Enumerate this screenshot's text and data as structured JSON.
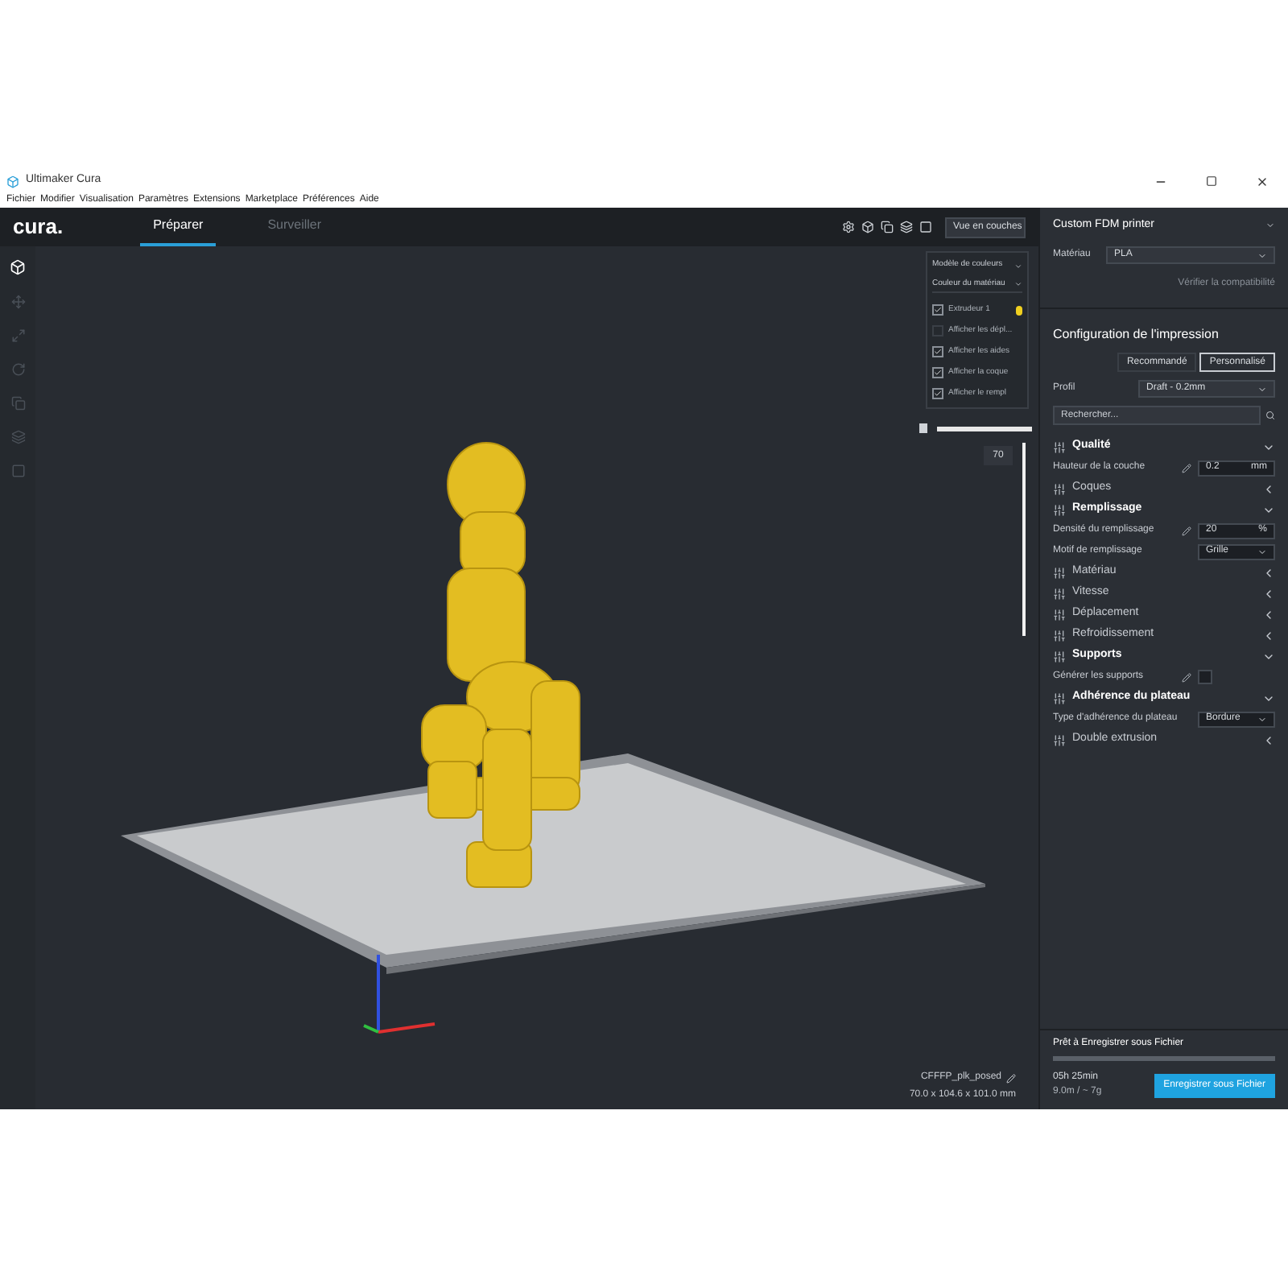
{
  "window": {
    "title": "Ultimaker Cura"
  },
  "logo": "cura.",
  "menu": [
    "Fichier",
    "Modifier",
    "Visualisation",
    "Paramètres",
    "Extensions",
    "Marketplace",
    "Préférences",
    "Aide"
  ],
  "tabs": [
    {
      "label": "Préparer",
      "selected": true
    },
    {
      "label": "Surveiller",
      "selected": false
    }
  ],
  "view_selector": {
    "value": "Vue en couches"
  },
  "layer_panel": {
    "color_scheme_label": "Modèle de couleurs",
    "color_scheme": "Couleur du matériau",
    "options": [
      {
        "label": "Extrudeur 1",
        "checked": true,
        "color": "#f0d020"
      },
      {
        "label": "Afficher les dépl...",
        "checked": false
      },
      {
        "label": "Afficher les aides",
        "checked": true
      },
      {
        "label": "Afficher la coque",
        "checked": true
      },
      {
        "label": "Afficher le rempl",
        "checked": true
      }
    ]
  },
  "path_slider": {
    "level": 1
  },
  "layer_slider": {
    "value": "70",
    "level": 1
  },
  "model_info": {
    "name": "CFFFP_plk_posed",
    "dimensions": "70.0 x 104.6 x 101.0 mm"
  },
  "printer": {
    "name": "Custom FDM printer",
    "material_label": "Matériau",
    "material": "PLA",
    "compat_link": "Vérifier la compatibilité"
  },
  "print_setup": {
    "title": "Configuration de l'impression",
    "modes": [
      {
        "label": "Recommandé",
        "selected": false
      },
      {
        "label": "Personnalisé",
        "selected": true
      }
    ],
    "profile_label": "Profil",
    "profile": "Draft - 0.2mm",
    "search_placeholder": "Rechercher...",
    "settings": [
      {
        "kind": "category",
        "label": "Qualité",
        "expanded": true
      },
      {
        "kind": "field",
        "label": "Hauteur de la couche",
        "value": "0.2",
        "unit": "mm"
      },
      {
        "kind": "category",
        "label": "Coques",
        "expanded": false
      },
      {
        "kind": "category",
        "label": "Remplissage",
        "expanded": true
      },
      {
        "kind": "field",
        "label": "Densité du remplissage",
        "value": "20",
        "unit": "%"
      },
      {
        "kind": "select",
        "label": "Motif de remplissage",
        "value": "Grille"
      },
      {
        "kind": "category",
        "label": "Matériau",
        "expanded": false
      },
      {
        "kind": "category",
        "label": "Vitesse",
        "expanded": false
      },
      {
        "kind": "category",
        "label": "Déplacement",
        "expanded": false
      },
      {
        "kind": "category",
        "label": "Refroidissement",
        "expanded": false
      },
      {
        "kind": "category",
        "label": "Supports",
        "expanded": true
      },
      {
        "kind": "checkbox",
        "label": "Générer les supports",
        "checked": false
      },
      {
        "kind": "category",
        "label": "Adhérence du plateau",
        "expanded": true
      },
      {
        "kind": "select",
        "label": "Type d'adhérence du plateau",
        "value": "Bordure"
      },
      {
        "kind": "category",
        "label": "Double extrusion",
        "expanded": false
      }
    ]
  },
  "output": {
    "status": "Prêt à Enregistrer sous Fichier",
    "level": 1,
    "time": "05h 25min",
    "material_usage": "9.0m / ~ 7g",
    "save_button": "Enregistrer sous Fichier"
  }
}
